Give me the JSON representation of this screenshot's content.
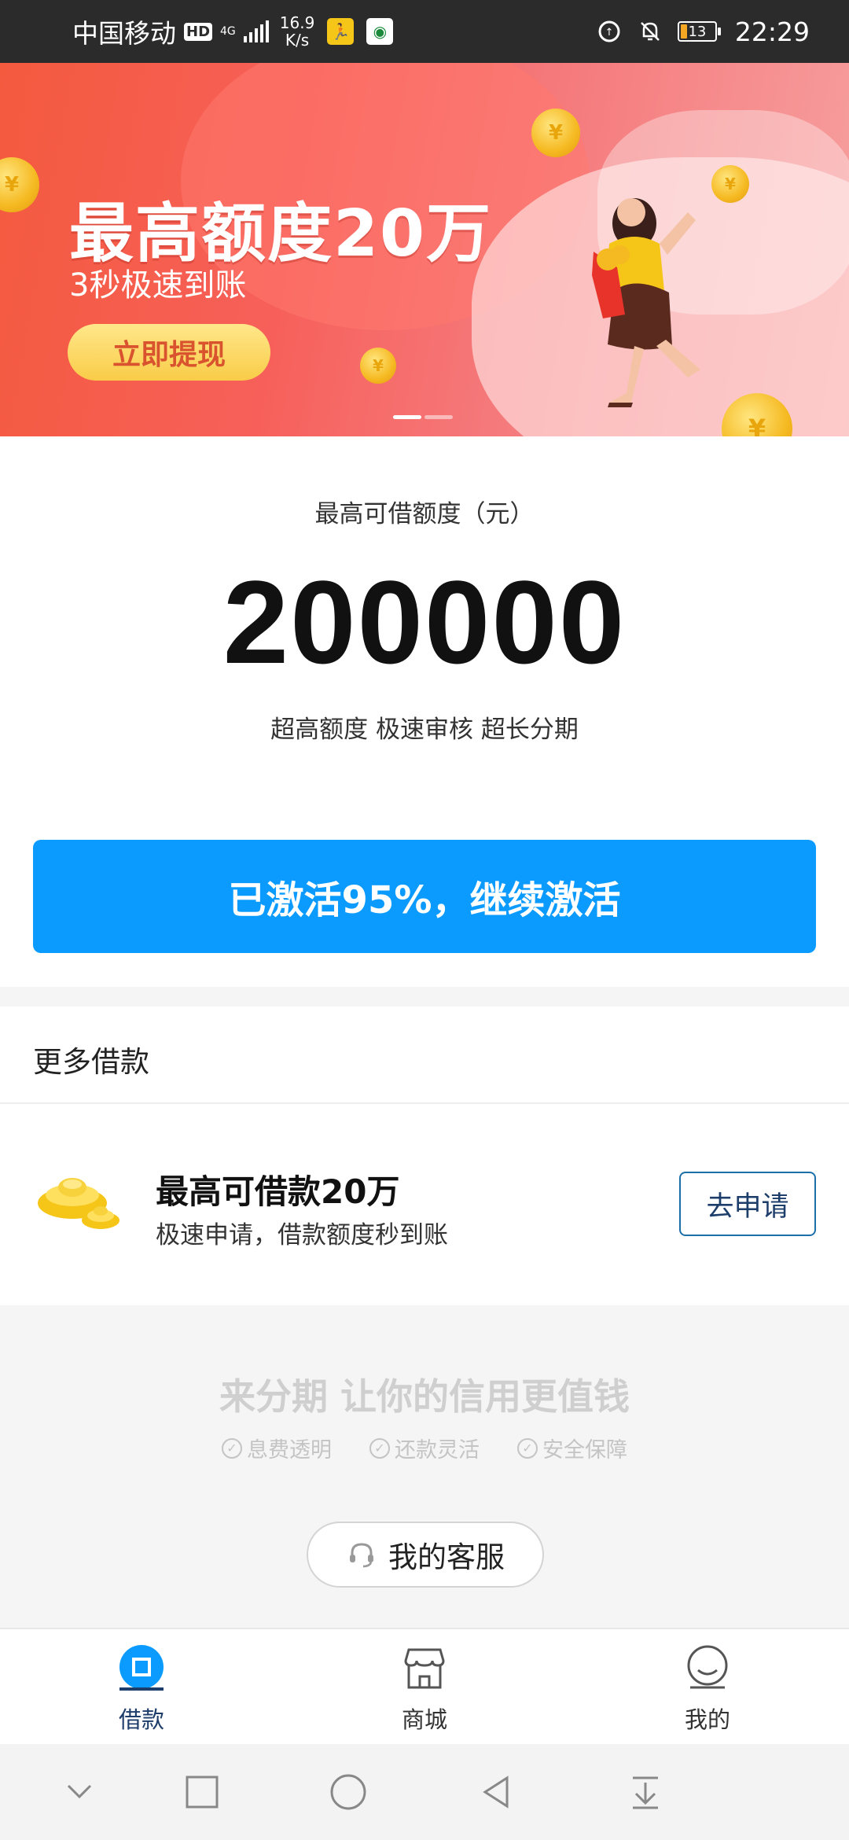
{
  "status_bar": {
    "carrier": "中国移动",
    "hd": "HD",
    "network": "4G",
    "speed_value": "16.9",
    "speed_unit": "K/s",
    "battery": "13",
    "time": "22:29"
  },
  "banner": {
    "title": "最高额度20万",
    "subtitle": "3秒极速到账",
    "button": "立即提现",
    "coin_symbol": "¥"
  },
  "limit": {
    "label": "最高可借额度（元）",
    "amount": "200000",
    "tags": "超高额度 极速审核 超长分期"
  },
  "activate_button": "已激活95%，继续激活",
  "more_loans": {
    "title": "更多借款",
    "item": {
      "title": "最高可借款20万",
      "desc": "极速申请，借款额度秒到账",
      "button": "去申请"
    }
  },
  "footer": {
    "slogan": "来分期 让你的信用更值钱",
    "features": [
      "息费透明",
      "还款灵活",
      "安全保障"
    ],
    "service_button": "我的客服"
  },
  "tabs": [
    {
      "label": "借款",
      "icon": "loan-icon",
      "active": true
    },
    {
      "label": "商城",
      "icon": "store-icon",
      "active": false
    },
    {
      "label": "我的",
      "icon": "profile-icon",
      "active": false
    }
  ],
  "colors": {
    "accent": "#0b9bff",
    "tab_active": "#1d3d6a",
    "banner_start": "#f45a3e"
  }
}
